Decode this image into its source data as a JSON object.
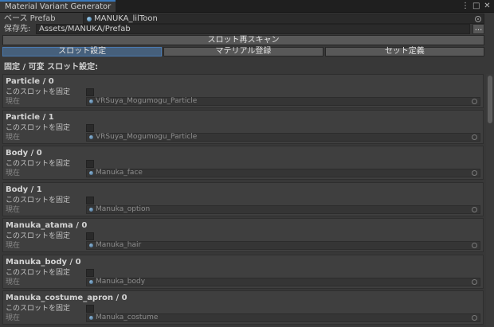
{
  "window": {
    "title": "Material Variant Generator"
  },
  "fields": {
    "base_prefab_label": "ベース Prefab",
    "base_prefab_value": "MANUKA_lilToon",
    "save_to_label": "保存先:",
    "save_to_value": "Assets/MANUKA/Prefab",
    "browse_label": "..."
  },
  "rescan_label": "スロット再スキャン",
  "tabs": [
    {
      "label": "スロット設定",
      "active": true
    },
    {
      "label": "マテリアル登録",
      "active": false
    },
    {
      "label": "セット定義",
      "active": false
    }
  ],
  "section_heading": "固定 / 可変 スロット設定:",
  "slot_labels": {
    "lock": "このスロットを固定",
    "current": "現在"
  },
  "slots": [
    {
      "title": "Particle / 0",
      "material": "VRSuya_Mogumogu_Particle",
      "locked": false
    },
    {
      "title": "Particle / 1",
      "material": "VRSuya_Mogumogu_Particle",
      "locked": false
    },
    {
      "title": "Body / 0",
      "material": "Manuka_face",
      "locked": false
    },
    {
      "title": "Body / 1",
      "material": "Manuka_option",
      "locked": false
    },
    {
      "title": "Manuka_atama / 0",
      "material": "Manuka_hair",
      "locked": false
    },
    {
      "title": "Manuka_body / 0",
      "material": "Manuka_body",
      "locked": false
    },
    {
      "title": "Manuka_costume_apron / 0",
      "material": "Manuka_costume",
      "locked": false
    }
  ],
  "colors": {
    "background": "#383838",
    "active_tab": "#46607c",
    "accent": "#3a79bb"
  }
}
